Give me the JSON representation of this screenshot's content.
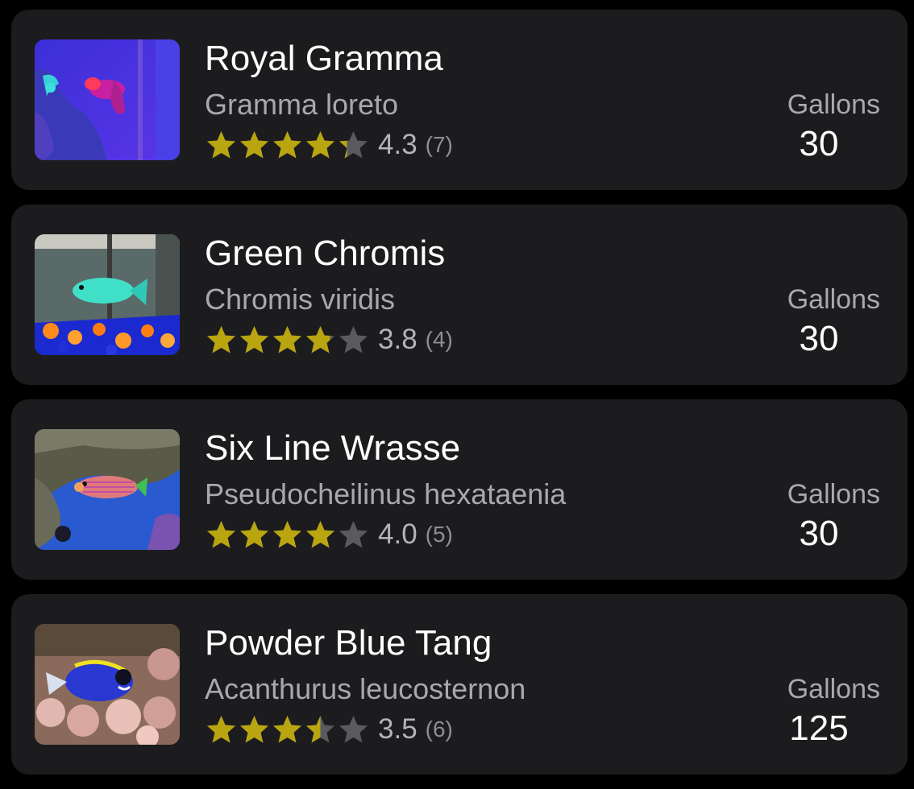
{
  "colors": {
    "card_bg": "#1c1c1e",
    "star_filled": "#b8a510",
    "star_empty": "#5a5a5e",
    "text_primary": "#ffffff",
    "text_secondary": "#a8a8ad"
  },
  "fish": [
    {
      "name": "Royal Gramma",
      "scientific": "Gramma loreto",
      "rating": 4.3,
      "rating_text": "4.3",
      "review_count": "(7)",
      "gallons_label": "Gallons",
      "gallons": "30",
      "thumbnail_icon": "royal-gramma-photo"
    },
    {
      "name": "Green Chromis",
      "scientific": "Chromis viridis",
      "rating": 3.8,
      "rating_text": "3.8",
      "review_count": "(4)",
      "gallons_label": "Gallons",
      "gallons": "30",
      "thumbnail_icon": "green-chromis-photo"
    },
    {
      "name": "Six Line Wrasse",
      "scientific": "Pseudocheilinus hexataenia",
      "rating": 4.0,
      "rating_text": "4.0",
      "review_count": "(5)",
      "gallons_label": "Gallons",
      "gallons": "30",
      "thumbnail_icon": "six-line-wrasse-photo"
    },
    {
      "name": "Powder Blue Tang",
      "scientific": "Acanthurus leucosternon",
      "rating": 3.5,
      "rating_text": "3.5",
      "review_count": "(6)",
      "gallons_label": "Gallons",
      "gallons": "125",
      "thumbnail_icon": "powder-blue-tang-photo"
    }
  ]
}
